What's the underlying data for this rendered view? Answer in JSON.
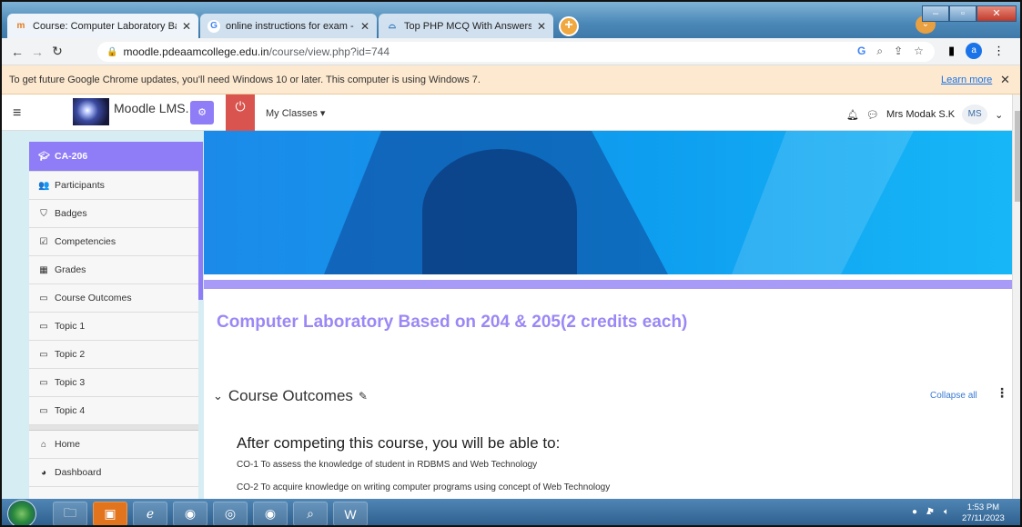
{
  "browser": {
    "tabs": [
      {
        "title": "Course: Computer Laboratory Ba",
        "favicon": "moodle-favicon",
        "active": true
      },
      {
        "title": "online instructions for exam - Go",
        "favicon": "google-favicon",
        "active": false
      },
      {
        "title": "Top PHP MCQ With Answers",
        "favicon": "site-favicon",
        "active": false
      }
    ],
    "new_tab": "+",
    "url_domain": "moodle.pdeaamcollege.edu.in",
    "url_path": "/course/view.php?id=744",
    "profile_initial": "a"
  },
  "infobar": {
    "message": "To get future Google Chrome updates, you'll need Windows 10 or later. This computer is using Windows 7.",
    "learn_more": "Learn more",
    "close": "✕"
  },
  "moodle_nav": {
    "brand": "Moodle LMS.",
    "my_classes": "My Classes ▾",
    "user_name": "Mrs Modak S.K",
    "user_initials": "MS"
  },
  "sidebar": {
    "course_code": "CA-206",
    "items": [
      {
        "label": "Participants",
        "icon": "participants-icon",
        "glyph": "👥"
      },
      {
        "label": "Badges",
        "icon": "badge-icon",
        "glyph": "⛉"
      },
      {
        "label": "Competencies",
        "icon": "check-square-icon",
        "glyph": "☑"
      },
      {
        "label": "Grades",
        "icon": "grid-icon",
        "glyph": "▦"
      },
      {
        "label": "Course Outcomes",
        "icon": "folder-icon",
        "glyph": "▭"
      },
      {
        "label": "Topic 1",
        "icon": "folder-icon",
        "glyph": "▭"
      },
      {
        "label": "Topic 2",
        "icon": "folder-icon",
        "glyph": "▭"
      },
      {
        "label": "Topic 3",
        "icon": "folder-icon",
        "glyph": "▭"
      },
      {
        "label": "Topic 4",
        "icon": "folder-icon",
        "glyph": "▭"
      }
    ],
    "secondary": [
      {
        "label": "Home",
        "icon": "home-icon",
        "glyph": "⌂"
      },
      {
        "label": "Dashboard",
        "icon": "dashboard-icon",
        "glyph": "◕"
      }
    ]
  },
  "content": {
    "course_title": "Computer Laboratory Based on 204 & 205(2 credits each)",
    "section_title": "Course Outcomes",
    "collapse_all": "Collapse all",
    "intro": "After competing this course, you will be able to:",
    "outcomes": [
      "CO-1 To assess the knowledge of student in RDBMS and Web Technology",
      "CO-2 To acquire knowledge on writing computer programs using concept of Web Technology"
    ]
  },
  "taskbar": {
    "time": "1:53 PM",
    "date": "27/11/2023"
  },
  "colors": {
    "moodle_accent": "#8f7cf7",
    "course_title": "#9b87f5",
    "link": "#3a7bd5",
    "power_button": "#d9534f"
  }
}
